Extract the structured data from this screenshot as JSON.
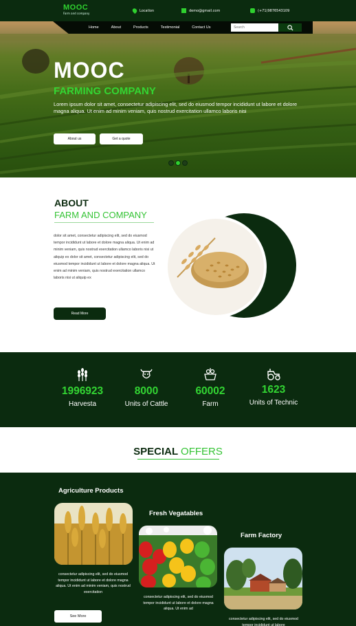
{
  "brand": {
    "name": "MOOC",
    "tagline": "Farm and company"
  },
  "topbar": {
    "location": "Location",
    "email": "demo@gmail.com",
    "phone": "(+71)9876543109"
  },
  "nav": {
    "items": [
      "Home",
      "About",
      "Products",
      "Testimonial",
      "Contact Us"
    ],
    "search_placeholder": "Search"
  },
  "hero": {
    "title": "MOOC",
    "subtitle": "FARMING COMPANY",
    "text": "Lorem ipsum dolor sit amet, consectetur adipiscing elit, sed do eiusmod tempor incididunt ut labore et dolore magna aliqua. Ut enim ad minim veniam, quis nostrud exercitation ullamco laboris nisi",
    "btn_about": "About us",
    "btn_quote": "Get a quote",
    "slide_active": 2,
    "slide_count": 3
  },
  "about": {
    "heading": "ABOUT",
    "subheading": "FARM AND COMPANY",
    "text": "dolor sit amet, consectetur adipiscing elit, sed do eiusmod tempor incididunt ut labore et dolore magna aliqua. Ut enim ad minim veniam, quis nostrud exercitation ullamco laboris nisi ut aliquip ex dolor sit amet, consectetur adipiscing elit, sed do eiusmod tempor incididunt ut labore et dolore magna aliqua. Ut enim ad minim veniam, quis nostrud exercitation ullamco laboris nisi ut aliquip ex",
    "button": "Read More"
  },
  "stats": [
    {
      "value": "1996923",
      "label": "Harvesta",
      "icon": "wheat-icon"
    },
    {
      "value": "8000",
      "label": "Units of Cattle",
      "icon": "cow-icon"
    },
    {
      "value": "60002",
      "label": "Farm",
      "icon": "basket-icon"
    },
    {
      "value": "1623",
      "label": "Units of Technic",
      "icon": "tractor-icon"
    }
  ],
  "offers": {
    "title_word1": "SPECIAL",
    "title_word2": "OFFERS",
    "cards": [
      {
        "title": "Agriculture Products",
        "text": "consectetur adipiscing elit, sed do eiusmod tempor incididunt ut labore et dolore magna aliqua. Ut enim ad minim veniam, quis nostrud exercitation"
      },
      {
        "title": "Fresh Vegatables",
        "text": "consectetur adipiscing elit, sed do eiusmod tempor incididunt ut labore et dolore magna aliqua. Ut enim ad"
      },
      {
        "title": "Farm Factory",
        "text": "consectetur adipiscing elit, sed do eiusmod tempor incididunt ut labore"
      }
    ],
    "see_more": "See More"
  }
}
